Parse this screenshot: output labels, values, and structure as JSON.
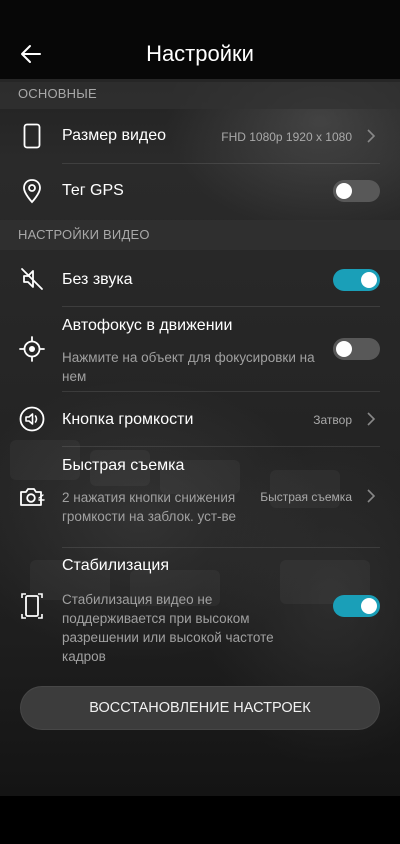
{
  "header": {
    "title": "Настройки"
  },
  "sections": {
    "basic": "ОСНОВНЫЕ",
    "video": "НАСТРОЙКИ ВИДЕО"
  },
  "items": {
    "video_size": {
      "label": "Размер видео",
      "value": "FHD 1080p 1920 x 1080"
    },
    "gps_tag": {
      "label": "Тег GPS",
      "toggle": "off"
    },
    "mute": {
      "label": "Без звука",
      "toggle": "on"
    },
    "autofocus": {
      "label": "Автофокус в движении",
      "sub": "Нажмите на объект для фокусировки на нем",
      "toggle": "off"
    },
    "volume_key": {
      "label": "Кнопка громкости",
      "value": "Затвор"
    },
    "quick_shot": {
      "label": "Быстрая съемка",
      "sub": "2 нажатия кнопки снижения громкости на заблок. уст-ве",
      "value": "Быстрая съемка"
    },
    "stabilization": {
      "label": "Стабилизация",
      "sub": "Стабилизация видео не поддерживается при высоком разрешении или высокой частоте кадров",
      "toggle": "on"
    }
  },
  "reset_button": "ВОССТАНОВЛЕНИЕ НАСТРОЕК",
  "colors": {
    "accent": "#1a9fb8",
    "toggle_off": "#585858",
    "header_bg": "#070707"
  },
  "icons": {
    "back": "arrow-left-icon",
    "video_size": "phone-outline-icon",
    "gps": "location-pin-icon",
    "mute": "speaker-muted-icon",
    "autofocus": "focus-target-icon",
    "volume": "speaker-circle-icon",
    "quick_shot": "camera-quick-icon",
    "stabilization": "phone-stabilization-icon",
    "chevron": "chevron-right-icon"
  }
}
